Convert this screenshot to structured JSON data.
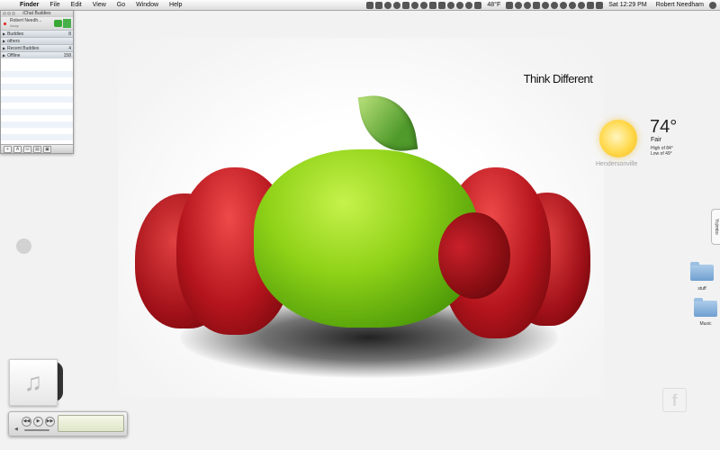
{
  "menubar": {
    "app": "Finder",
    "items": [
      "File",
      "Edit",
      "View",
      "Go",
      "Window",
      "Help"
    ],
    "weather_small": "48°F",
    "clock": "Sat 12:29 PM",
    "user": "Robert Needham"
  },
  "ichat": {
    "title": "iChat Buddies",
    "user": "Robert Needh...",
    "status": "Away",
    "groups": [
      {
        "name": "Buddies",
        "count": "8"
      },
      {
        "name": "others",
        "count": ""
      },
      {
        "name": "Recent Buddies",
        "count": "4"
      },
      {
        "name": "Offline",
        "count": "158"
      }
    ],
    "toolbar": [
      "+",
      "A",
      "☏",
      "▤",
      "▣"
    ]
  },
  "desktop": {
    "think_different": "Think Different",
    "weather": {
      "temp": "74°",
      "condition": "Fair",
      "high": "High of 84°",
      "low": "Low of 49°",
      "city": "Hendersonville"
    },
    "side_tab": "Yojimbo",
    "folders": [
      {
        "label": "stuff"
      },
      {
        "label": "Music"
      }
    ],
    "fb_glyph": "f"
  },
  "player": {
    "album_icon": "music-note",
    "lcd_glyph": ""
  },
  "colors": {
    "menubar": "#e8e8e8",
    "apple_green": "#8fd218",
    "apple_red": "#b3141c"
  }
}
